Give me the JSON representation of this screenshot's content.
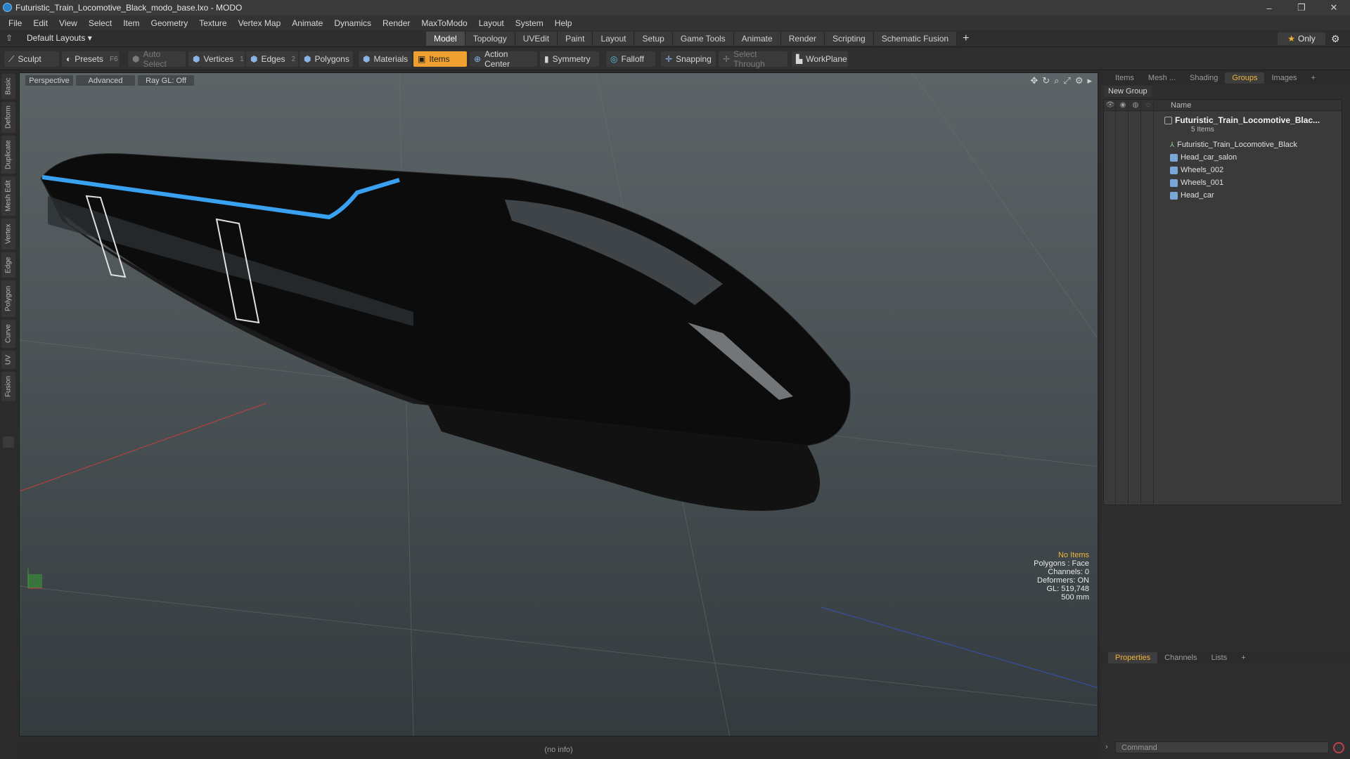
{
  "window": {
    "title": "Futuristic_Train_Locomotive_Black_modo_base.lxo - MODO",
    "min": "–",
    "max": "❐",
    "close": "✕"
  },
  "menu": [
    "File",
    "Edit",
    "View",
    "Select",
    "Item",
    "Geometry",
    "Texture",
    "Vertex Map",
    "Animate",
    "Dynamics",
    "Render",
    "MaxToModo",
    "Layout",
    "System",
    "Help"
  ],
  "layout_selector": "Default Layouts ▾",
  "mode_tabs": [
    "Model",
    "Topology",
    "UVEdit",
    "Paint",
    "Layout",
    "Setup",
    "Game Tools",
    "Animate",
    "Render",
    "Scripting",
    "Schematic Fusion"
  ],
  "active_mode_tab": "Model",
  "tab_add": "+",
  "only_label": "Only",
  "toolbar": {
    "sculpt": "Sculpt",
    "presets": "Presets",
    "presets_key": "F6",
    "auto_select": "Auto Select",
    "vertices": "Vertices",
    "vertices_key": "1",
    "edges": "Edges",
    "edges_key": "2",
    "polygons": "Polygons",
    "materials": "Materials",
    "items": "Items",
    "action_center": "Action Center",
    "symmetry": "Symmetry",
    "falloff": "Falloff",
    "snapping": "Snapping",
    "select_through": "Select Through",
    "workplane": "WorkPlane"
  },
  "left_tabs": [
    "Basic",
    "Deform",
    "Duplicate",
    "Mesh Edit",
    "Vertex",
    "Edge",
    "Polygon",
    "Curve",
    "UV",
    "Fusion"
  ],
  "viewport": {
    "view": "Perspective",
    "shading": "Advanced",
    "raygl": "Ray GL: Off",
    "info": {
      "items": "No Items",
      "polygons": "Polygons : Face",
      "channels": "Channels: 0",
      "deformers": "Deformers: ON",
      "gl": "GL: 519,748",
      "grid": "500 mm"
    }
  },
  "status": "(no info)",
  "right_panel": {
    "tabs": [
      "Items",
      "Mesh ...",
      "Shading",
      "Groups",
      "Images"
    ],
    "active_tab": "Groups",
    "new_group": "New Group",
    "column_name": "Name",
    "group_name": "Futuristic_Train_Locomotive_Blac...",
    "group_count": "5 Items",
    "items": [
      "Futuristic_Train_Locomotive_Black",
      "Head_car_salon",
      "Wheels_002",
      "Wheels_001",
      "Head_car"
    ],
    "bottom_tabs": [
      "Properties",
      "Channels",
      "Lists"
    ],
    "bottom_active": "Properties",
    "command_placeholder": "Command"
  },
  "colors": {
    "accent": "#f0a030",
    "train_stripe": "#3aa0f0"
  }
}
